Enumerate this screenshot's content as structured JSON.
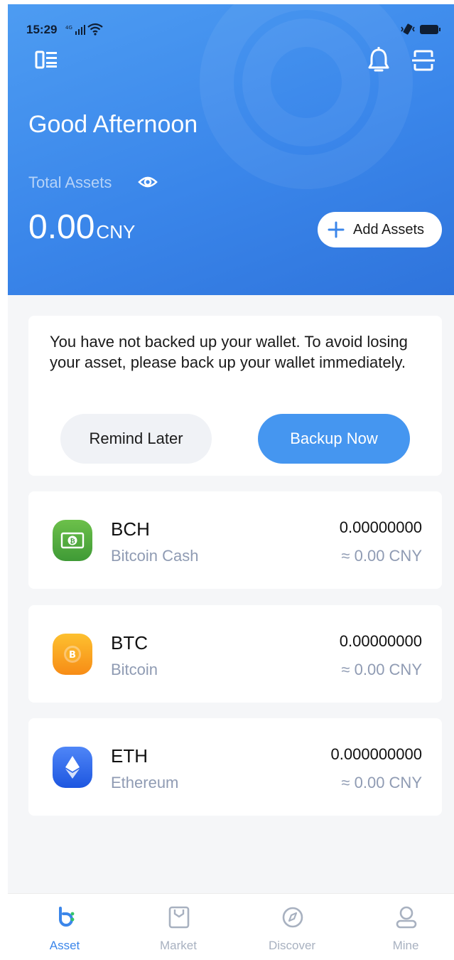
{
  "status_bar": {
    "time": "15:29",
    "network_badge": "4G"
  },
  "header": {
    "greeting": "Good Afternoon",
    "total_assets_label": "Total Assets",
    "total_amount": "0.00",
    "currency": "CNY",
    "add_assets_label": "Add Assets",
    "icons": [
      "menu-icon",
      "bell-icon",
      "scan-icon",
      "eye-icon"
    ]
  },
  "backup_prompt": {
    "message": "You have not backed up your wallet. To avoid losing your asset, please back up your wallet immediately.",
    "remind_later_label": "Remind Later",
    "backup_now_label": "Backup Now"
  },
  "assets": [
    {
      "symbol": "BCH",
      "name": "Bitcoin Cash",
      "balance": "0.00000000",
      "value": "≈ 0.00 CNY",
      "icon": "bch-coin-icon",
      "color": "#4caf50"
    },
    {
      "symbol": "BTC",
      "name": "Bitcoin",
      "balance": "0.00000000",
      "value": "≈ 0.00 CNY",
      "icon": "btc-coin-icon",
      "color": "#f7a21c"
    },
    {
      "symbol": "ETH",
      "name": "Ethereum",
      "balance": "0.000000000",
      "value": "≈ 0.00 CNY",
      "icon": "eth-coin-icon",
      "color": "#2f6ff0"
    }
  ],
  "bottom_nav": [
    {
      "label": "Asset",
      "icon": "asset-icon",
      "active": true
    },
    {
      "label": "Market",
      "icon": "market-icon",
      "active": false
    },
    {
      "label": "Discover",
      "icon": "discover-icon",
      "active": false
    },
    {
      "label": "Mine",
      "icon": "mine-icon",
      "active": false
    }
  ],
  "colors": {
    "primary": "#3b86ea",
    "background": "#f5f6f8",
    "muted_text": "#8f9bb3"
  }
}
